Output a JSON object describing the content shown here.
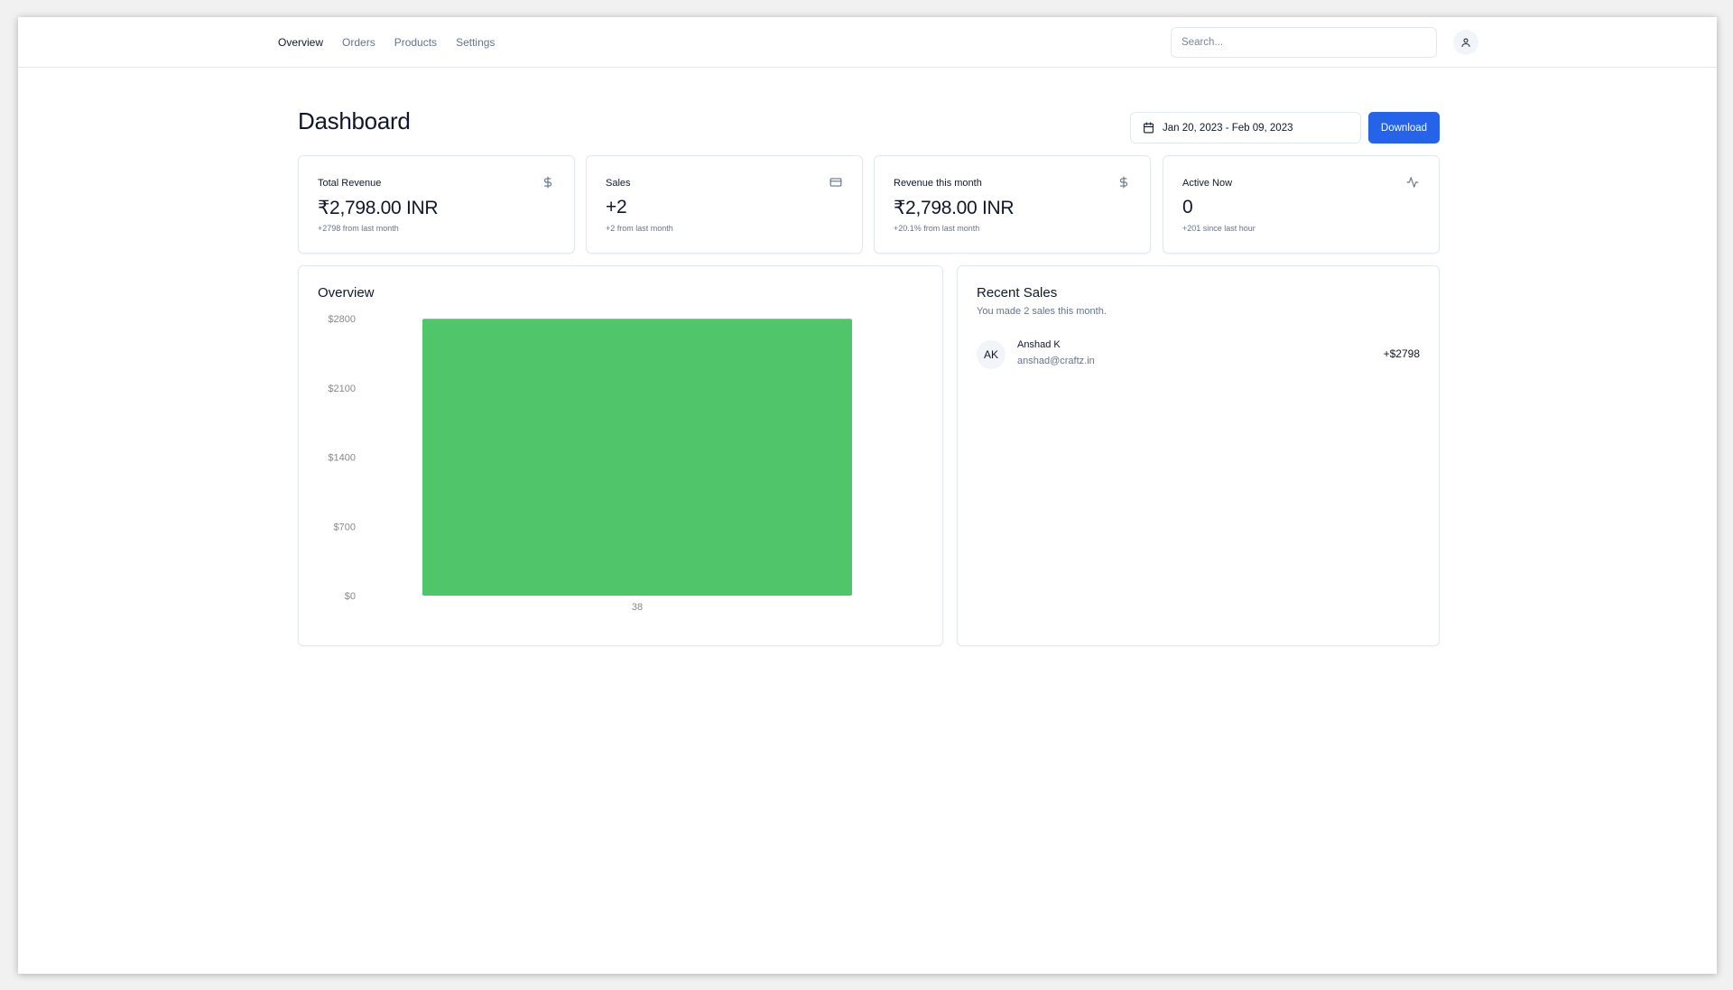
{
  "nav": {
    "items": [
      {
        "label": "Overview",
        "active": true
      },
      {
        "label": "Orders",
        "active": false
      },
      {
        "label": "Products",
        "active": false
      },
      {
        "label": "Settings",
        "active": false
      }
    ],
    "search_placeholder": "Search...",
    "user_icon": "user-icon"
  },
  "header": {
    "title": "Dashboard",
    "date_range": "Jan 20, 2023 - Feb 09, 2023",
    "download_label": "Download"
  },
  "stats": [
    {
      "label": "Total Revenue",
      "value": "₹2,798.00 INR",
      "sub": "+2798 from last month",
      "icon": "dollar-icon"
    },
    {
      "label": "Sales",
      "value": "+2",
      "sub": "+2 from last month",
      "icon": "credit-card-icon"
    },
    {
      "label": "Revenue this month",
      "value": "₹2,798.00 INR",
      "sub": "+20.1% from last month",
      "icon": "dollar-icon"
    },
    {
      "label": "Active Now",
      "value": "0",
      "sub": "+201 since last hour",
      "icon": "activity-icon"
    }
  ],
  "overview": {
    "title": "Overview"
  },
  "chart_data": {
    "type": "bar",
    "categories": [
      "38"
    ],
    "values": [
      2798
    ],
    "ytick_labels": [
      "$0",
      "$700",
      "$1400",
      "$2100",
      "$2800"
    ],
    "ylim": [
      0,
      2800
    ],
    "bar_color": "#50c56a",
    "grid": false
  },
  "recent_sales": {
    "title": "Recent Sales",
    "subtitle": "You made 2 sales this month.",
    "items": [
      {
        "initials": "AK",
        "name": "Anshad K",
        "email": "anshad@craftz.in",
        "amount": "+$2798"
      }
    ]
  },
  "colors": {
    "accent": "#2563eb",
    "bar": "#50c56a",
    "muted": "#64748b",
    "border": "#e2e8f0"
  }
}
